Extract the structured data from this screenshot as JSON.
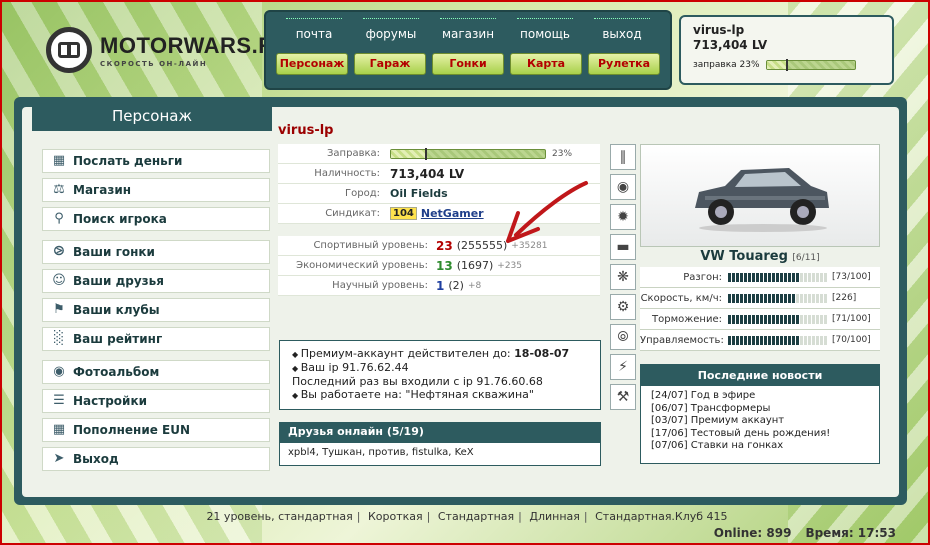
{
  "logo": {
    "name": "MOTORWARS.RU",
    "tagline": "СКОРОСТЬ ОН-ЛАЙН"
  },
  "topnav": {
    "row1": [
      "почта",
      "форумы",
      "магазин",
      "помощь",
      "выход"
    ],
    "row2": [
      "Персонаж",
      "Гараж",
      "Гонки",
      "Карта",
      "Рулетка"
    ]
  },
  "userbox": {
    "name": "virus-lp",
    "money": "713,404 LV",
    "fuel_label": "заправка 23%",
    "fuel_fraction": 0.23
  },
  "sidebar": {
    "title": "Персонаж",
    "groups": [
      [
        {
          "label": "Послать деньги",
          "icon": "money-icon"
        },
        {
          "label": "Магазин",
          "icon": "shop-icon"
        },
        {
          "label": "Поиск игрока",
          "icon": "search-icon"
        }
      ],
      [
        {
          "label": "Ваши гонки",
          "icon": "steering-wheel-icon"
        },
        {
          "label": "Ваши друзья",
          "icon": "friends-icon"
        },
        {
          "label": "Ваши клубы",
          "icon": "clubs-icon"
        },
        {
          "label": "Ваш рейтинг",
          "icon": "chart-icon"
        }
      ],
      [
        {
          "label": "Фотоальбом",
          "icon": "camera-icon"
        },
        {
          "label": "Настройки",
          "icon": "settings-icon"
        },
        {
          "label": "Пополнение EUN",
          "icon": "money-icon"
        },
        {
          "label": "Выход",
          "icon": "exit-icon"
        }
      ]
    ]
  },
  "profile": {
    "name": "virus-lp",
    "fuel_label": "Заправка:",
    "fuel_percent": "23%",
    "fuel_fraction": 0.23,
    "cash_label": "Наличность:",
    "cash": "713,404 LV",
    "city_label": "Город:",
    "city": "Oil Fields",
    "syndicate_label": "Синдикат:",
    "syndicate_id": "104",
    "syndicate_name": "NetGamer"
  },
  "levels": [
    {
      "label": "Спортивный уровень:",
      "level": "23",
      "points": "(255555)",
      "plus": "+35281",
      "color": "#b30000"
    },
    {
      "label": "Экономический уровень:",
      "level": "13",
      "points": "(1697)",
      "plus": "+235",
      "color": "#2e8b2e"
    },
    {
      "label": "Научный уровень:",
      "level": "1",
      "points": "(2)",
      "plus": "+8",
      "color": "#1f3fa0"
    }
  ],
  "notes": {
    "premium_label": "Премиум-аккаунт действителен до:",
    "premium_date": "18-08-07",
    "ip_line": "Ваш ip 91.76.62.44",
    "last_login": "Последний раз вы входили с ip 91.76.60.68",
    "work_line": "Вы работаете на: \"Нефтяная скважина\""
  },
  "friends": {
    "title": "Друзья онлайн (5/19)",
    "list": "xpbl4, Тушкан, против, fistulka, KeX"
  },
  "right_icons": [
    "shocks-icon",
    "tire-icon",
    "rims-icon",
    "exhaust-icon",
    "turbo-icon",
    "engine-icon",
    "brakes-icon",
    "nitro-icon",
    "tuning-icon"
  ],
  "car": {
    "name": "VW Touareg",
    "slot": "[6/11]",
    "stats": [
      {
        "label": "Разгон:",
        "value": "[73/100]",
        "fraction": 0.73
      },
      {
        "label": "Скорость, км/ч:",
        "value": "[226]",
        "fraction": 0.66
      },
      {
        "label": "Торможение:",
        "value": "[71/100]",
        "fraction": 0.71
      },
      {
        "label": "Управляемость:",
        "value": "[70/100]",
        "fraction": 0.7
      }
    ]
  },
  "news": {
    "title": "Последние новости",
    "items": [
      "[24/07] Год в эфире",
      "[06/07] Трансформеры",
      "[03/07] Премиум аккаунт",
      "[17/06] Тестовый день рождения!",
      "[07/06] Ставки на гонках"
    ]
  },
  "footer": {
    "links": [
      "21 уровень, стандартная",
      "Короткая",
      "Стандартная",
      "Длинная",
      "Стандартная.Клуб 415"
    ],
    "online": "Online: 899",
    "time": "Время: 17:53"
  }
}
